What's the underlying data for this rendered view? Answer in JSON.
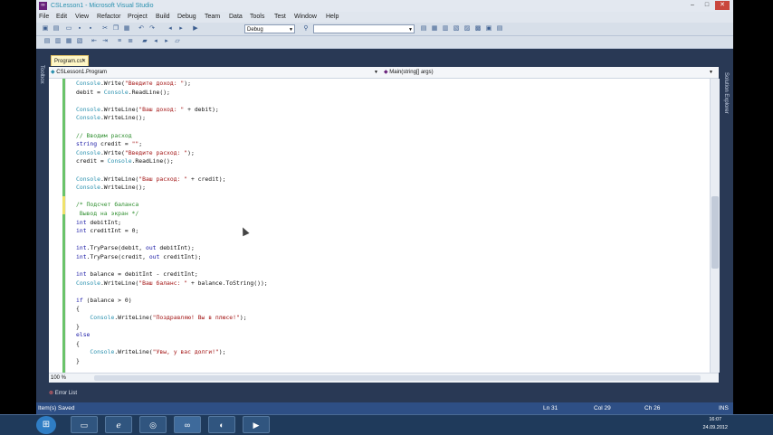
{
  "window": {
    "title": "CSLesson1 - Microsoft Visual Studio",
    "menus": [
      "File",
      "Edit",
      "View",
      "Refactor",
      "Project",
      "Build",
      "Debug",
      "Team",
      "Data",
      "Tools",
      "Test",
      "Window",
      "Help"
    ]
  },
  "toolbar": {
    "configuration": "Debug",
    "search": ""
  },
  "side": {
    "left_label": "Toolbox",
    "right_label": "Solution Explorer"
  },
  "document": {
    "tab": "Program.cs*",
    "class_combo": "CSLesson1.Program",
    "member_combo": "Main(string[] args)",
    "zoom": "100 %"
  },
  "code_lines": [
    [
      {
        "c": "t",
        "v": "Console"
      },
      {
        "c": "",
        "v": ".Write("
      },
      {
        "c": "s",
        "v": "\"Введите доход: \""
      },
      {
        "c": "",
        "v": ");"
      }
    ],
    [
      {
        "c": "",
        "v": "debit = "
      },
      {
        "c": "t",
        "v": "Console"
      },
      {
        "c": "",
        "v": ".ReadLine();"
      }
    ],
    [],
    [
      {
        "c": "t",
        "v": "Console"
      },
      {
        "c": "",
        "v": ".WriteLine("
      },
      {
        "c": "s",
        "v": "\"Ваш доход: \""
      },
      {
        "c": "",
        "v": " + debit);"
      }
    ],
    [
      {
        "c": "t",
        "v": "Console"
      },
      {
        "c": "",
        "v": ".WriteLine();"
      }
    ],
    [],
    [
      {
        "c": "c",
        "v": "// Вводим расход"
      }
    ],
    [
      {
        "c": "k",
        "v": "string"
      },
      {
        "c": "",
        "v": " credit = "
      },
      {
        "c": "s",
        "v": "\"\""
      },
      {
        "c": "",
        "v": ";"
      }
    ],
    [
      {
        "c": "t",
        "v": "Console"
      },
      {
        "c": "",
        "v": ".Write("
      },
      {
        "c": "s",
        "v": "\"Введите расход: \""
      },
      {
        "c": "",
        "v": ");"
      }
    ],
    [
      {
        "c": "",
        "v": "credit = "
      },
      {
        "c": "t",
        "v": "Console"
      },
      {
        "c": "",
        "v": ".ReadLine();"
      }
    ],
    [],
    [
      {
        "c": "t",
        "v": "Console"
      },
      {
        "c": "",
        "v": ".WriteLine("
      },
      {
        "c": "s",
        "v": "\"Ваш расход: \""
      },
      {
        "c": "",
        "v": " + credit);"
      }
    ],
    [
      {
        "c": "t",
        "v": "Console"
      },
      {
        "c": "",
        "v": ".WriteLine();"
      }
    ],
    [],
    [
      {
        "c": "c",
        "v": "/* Подсчет баланса"
      }
    ],
    [
      {
        "c": "c",
        "v": " Вывод на экран */"
      }
    ],
    [
      {
        "c": "k",
        "v": "int"
      },
      {
        "c": "",
        "v": " debitInt;"
      }
    ],
    [
      {
        "c": "k",
        "v": "int"
      },
      {
        "c": "",
        "v": " creditInt = 0;"
      }
    ],
    [],
    [
      {
        "c": "k",
        "v": "int"
      },
      {
        "c": "",
        "v": ".TryParse(debit, "
      },
      {
        "c": "k",
        "v": "out"
      },
      {
        "c": "",
        "v": " debitInt);"
      }
    ],
    [
      {
        "c": "k",
        "v": "int"
      },
      {
        "c": "",
        "v": ".TryParse(credit, "
      },
      {
        "c": "k",
        "v": "out"
      },
      {
        "c": "",
        "v": " creditInt);"
      }
    ],
    [],
    [
      {
        "c": "k",
        "v": "int"
      },
      {
        "c": "",
        "v": " balance = debitInt - creditInt;"
      }
    ],
    [
      {
        "c": "t",
        "v": "Console"
      },
      {
        "c": "",
        "v": ".WriteLine("
      },
      {
        "c": "s",
        "v": "\"Ваш баланс: \""
      },
      {
        "c": "",
        "v": " + balance.ToString());"
      }
    ],
    [],
    [
      {
        "c": "k",
        "v": "if"
      },
      {
        "c": "",
        "v": " (balance > 0)"
      }
    ],
    [
      {
        "c": "",
        "v": "{"
      }
    ],
    [
      {
        "c": "",
        "v": "    "
      },
      {
        "c": "t",
        "v": "Console"
      },
      {
        "c": "",
        "v": ".WriteLine("
      },
      {
        "c": "s",
        "v": "\"Поздравляю! Вы в плюсе!\""
      },
      {
        "c": "",
        "v": ");"
      }
    ],
    [
      {
        "c": "",
        "v": "}"
      }
    ],
    [
      {
        "c": "k",
        "v": "else"
      }
    ],
    [
      {
        "c": "",
        "v": "{"
      }
    ],
    [
      {
        "c": "",
        "v": "    "
      },
      {
        "c": "t",
        "v": "Console"
      },
      {
        "c": "",
        "v": ".WriteLine("
      },
      {
        "c": "s",
        "v": "\"Увы, у вас долги!\""
      },
      {
        "c": "",
        "v": ");"
      }
    ],
    [
      {
        "c": "",
        "v": "}"
      }
    ]
  ],
  "bottom": {
    "panel_tab": "Error List",
    "status": "Item(s) Saved",
    "ln": "Ln 31",
    "col": "Col 29",
    "ch": "Ch 26",
    "mode": "INS"
  },
  "taskbar": {
    "time": "16:07",
    "date": "24.09.2012"
  }
}
